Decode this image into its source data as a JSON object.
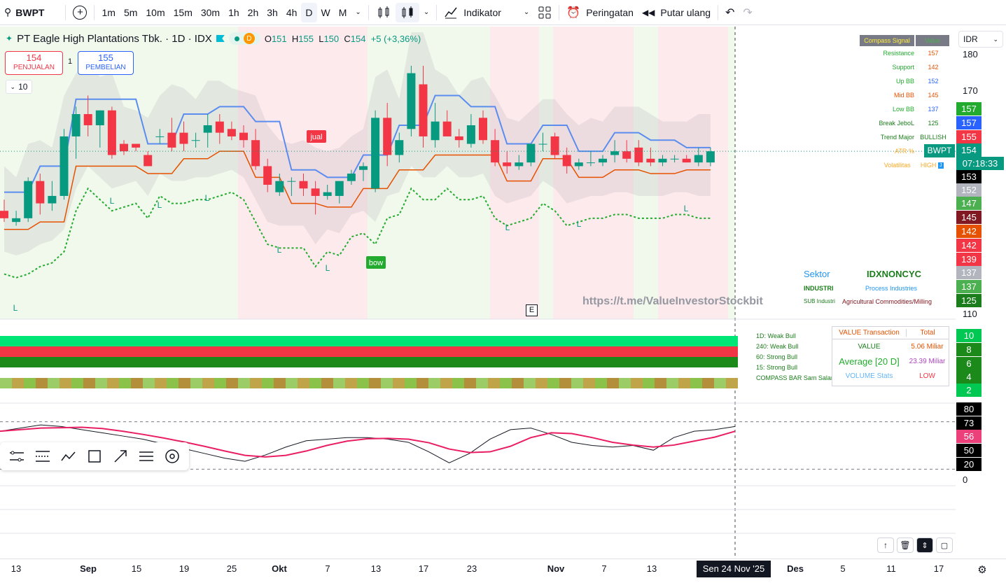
{
  "toolbar": {
    "symbol": "BWPT",
    "intervals": [
      "1m",
      "5m",
      "10m",
      "15m",
      "30m",
      "1h",
      "2h",
      "3h",
      "4h",
      "D",
      "W",
      "M"
    ],
    "selected_interval": "D",
    "indicators_label": "Indikator",
    "alert_label": "Peringatan",
    "replay_label": "Putar ulang"
  },
  "legend": {
    "title": "PT Eagle High Plantations Tbk. · 1D · IDX",
    "badge": "D",
    "o_label": "O",
    "o": "151",
    "h_label": "H",
    "h": "155",
    "l_label": "L",
    "l": "150",
    "c_label": "C",
    "c": "154",
    "change": "+5 (+3,36%)",
    "sell_price": "154",
    "sell_label": "PENJUALAN",
    "spread": "1",
    "buy_price": "155",
    "buy_label": "PEMBELIAN",
    "indicator_count": "10"
  },
  "currency": "IDR",
  "price_scale": {
    "plain_labels": [
      "180",
      "170",
      "110",
      "0"
    ],
    "tags": [
      {
        "text": "157",
        "color": "#22ab2e"
      },
      {
        "text": "157",
        "color": "#2962ff"
      },
      {
        "text": "155",
        "color": "#f23645"
      },
      {
        "text": "154",
        "color": "#089981"
      },
      {
        "text": "07:18:33",
        "color": "#089981"
      },
      {
        "text": "153",
        "color": "#000000"
      },
      {
        "text": "152",
        "color": "#b2b5be"
      },
      {
        "text": "147",
        "color": "#4caf50"
      },
      {
        "text": "145",
        "color": "#801922"
      },
      {
        "text": "142",
        "color": "#e65100"
      },
      {
        "text": "142",
        "color": "#f23645"
      },
      {
        "text": "139",
        "color": "#f23645"
      },
      {
        "text": "137",
        "color": "#b2b5be"
      },
      {
        "text": "137",
        "color": "#4caf50"
      },
      {
        "text": "125",
        "color": "#1b7d1b"
      },
      {
        "text": "10",
        "color": "#00c853"
      },
      {
        "text": "8",
        "color": "#1b8a1b"
      },
      {
        "text": "6",
        "color": "#1b8a1b"
      },
      {
        "text": "4",
        "color": "#1b8a1b"
      },
      {
        "text": "2",
        "color": "#00c853"
      },
      {
        "text": "80",
        "color": "#000000"
      },
      {
        "text": "73",
        "color": "#000000"
      },
      {
        "text": "56",
        "color": "#ec407a"
      },
      {
        "text": "50",
        "color": "#000000"
      },
      {
        "text": "20",
        "color": "#000000"
      }
    ],
    "symbol_tag": "BWPT"
  },
  "compass": {
    "header_signal": "Compass Signal",
    "header_value": "Value",
    "rows": [
      {
        "label": "Resistance",
        "value": "157",
        "lcolor": "#22ab2e",
        "vcolor": "#e65100"
      },
      {
        "label": "Support",
        "value": "142",
        "lcolor": "#22ab2e",
        "vcolor": "#e65100"
      },
      {
        "label": "Up BB",
        "value": "152",
        "lcolor": "#22ab2e",
        "vcolor": "#2962ff"
      },
      {
        "label": "Mid BB",
        "value": "145",
        "lcolor": "#e65100",
        "vcolor": "#e65100"
      },
      {
        "label": "Low BB",
        "value": "137",
        "lcolor": "#22ab2e",
        "vcolor": "#2962ff"
      },
      {
        "label": "Break JeboL",
        "value": "125",
        "lcolor": "#1b7d1b",
        "vcolor": "#1b7d1b"
      },
      {
        "label": "Trend Major",
        "value": "BULLISH",
        "lcolor": "#1b7d1b",
        "vcolor": "#1b7d1b"
      },
      {
        "label": "ATR %",
        "value": "",
        "lcolor": "#f9a825",
        "vcolor": "#f9a825"
      },
      {
        "label": "Volatilitas",
        "value": "HIGH",
        "lcolor": "#f9a825",
        "vcolor": "#f9a825"
      }
    ]
  },
  "sector": {
    "sektor_label": "Sektor",
    "sektor_value": "IDXNONCYC",
    "industri_label": "INDUSTRI",
    "industri_value": "Process Industries",
    "sub_label": "SUB Industri",
    "sub_value": "Agricultural Commodities/Milling"
  },
  "watermark": "https://t.me/ValueInvestorStockbit",
  "signals": {
    "jual": "jual",
    "bow": "bow",
    "L": "L"
  },
  "compass_bar": {
    "labels": [
      "1D: Weak Bull",
      "240: Weak Bull",
      "60: Strong Bull",
      "15: Strong Bull",
      "COMPASS BAR Sam Salamun"
    ]
  },
  "value_table": {
    "h1": "VALUE Transaction",
    "h2": "Total",
    "r1l": "VALUE",
    "r1v": "5.06 Miliar",
    "r2l": "Average [20 D]",
    "r2v": "23.39 Miliar",
    "r3l": "VOLUME Stats",
    "r3v": "LOW"
  },
  "x_axis": {
    "labels": [
      "13",
      "Sep",
      "15",
      "19",
      "25",
      "Okt",
      "7",
      "13",
      "17",
      "23",
      "Nov",
      "7",
      "13",
      "Des",
      "5",
      "11",
      "17"
    ],
    "crosshair_label": "Sen 24 Nov '25"
  },
  "chart_data": {
    "type": "candlestick",
    "ylim": [
      110,
      180
    ],
    "candles": [
      {
        "o": 138,
        "h": 141,
        "l": 135,
        "c": 136
      },
      {
        "o": 135,
        "h": 138,
        "l": 134,
        "c": 136
      },
      {
        "o": 136,
        "h": 147,
        "l": 135,
        "c": 146
      },
      {
        "o": 146,
        "h": 148,
        "l": 137,
        "c": 140
      },
      {
        "o": 140,
        "h": 146,
        "l": 138,
        "c": 142
      },
      {
        "o": 142,
        "h": 160,
        "l": 141,
        "c": 158
      },
      {
        "o": 158,
        "h": 166,
        "l": 152,
        "c": 164
      },
      {
        "o": 164,
        "h": 169,
        "l": 158,
        "c": 161
      },
      {
        "o": 161,
        "h": 165,
        "l": 155,
        "c": 165
      },
      {
        "o": 165,
        "h": 166,
        "l": 152,
        "c": 153
      },
      {
        "o": 156,
        "h": 157,
        "l": 153,
        "c": 154
      },
      {
        "o": 156,
        "h": 156,
        "l": 154,
        "c": 155
      },
      {
        "o": 153,
        "h": 154,
        "l": 150,
        "c": 150
      },
      {
        "o": 158,
        "h": 160,
        "l": 156,
        "c": 158
      },
      {
        "o": 159,
        "h": 163,
        "l": 154,
        "c": 155
      },
      {
        "o": 159,
        "h": 162,
        "l": 154,
        "c": 156
      },
      {
        "o": 157,
        "h": 159,
        "l": 155,
        "c": 157
      },
      {
        "o": 159,
        "h": 164,
        "l": 155,
        "c": 161
      },
      {
        "o": 162,
        "h": 164,
        "l": 156,
        "c": 159
      },
      {
        "o": 160,
        "h": 162,
        "l": 157,
        "c": 158
      },
      {
        "o": 159,
        "h": 161,
        "l": 155,
        "c": 157
      },
      {
        "o": 157,
        "h": 160,
        "l": 149,
        "c": 150
      },
      {
        "o": 150,
        "h": 152,
        "l": 143,
        "c": 145
      },
      {
        "o": 143,
        "h": 148,
        "l": 142,
        "c": 146
      },
      {
        "o": 146,
        "h": 147,
        "l": 142,
        "c": 146
      },
      {
        "o": 146,
        "h": 148,
        "l": 142,
        "c": 144
      },
      {
        "o": 144,
        "h": 146,
        "l": 137,
        "c": 142
      },
      {
        "o": 142,
        "h": 145,
        "l": 141,
        "c": 143
      },
      {
        "o": 142,
        "h": 146,
        "l": 140,
        "c": 146
      },
      {
        "o": 146,
        "h": 149,
        "l": 145,
        "c": 148
      },
      {
        "o": 149,
        "h": 151,
        "l": 146,
        "c": 150
      },
      {
        "o": 144,
        "h": 165,
        "l": 143,
        "c": 163
      },
      {
        "o": 163,
        "h": 167,
        "l": 150,
        "c": 153
      },
      {
        "o": 153,
        "h": 159,
        "l": 151,
        "c": 157
      },
      {
        "o": 160,
        "h": 177,
        "l": 158,
        "c": 175
      },
      {
        "o": 172,
        "h": 177,
        "l": 155,
        "c": 158
      },
      {
        "o": 157,
        "h": 167,
        "l": 155,
        "c": 162
      },
      {
        "o": 162,
        "h": 165,
        "l": 158,
        "c": 158
      },
      {
        "o": 158,
        "h": 160,
        "l": 155,
        "c": 157
      },
      {
        "o": 156,
        "h": 164,
        "l": 155,
        "c": 161
      },
      {
        "o": 163,
        "h": 165,
        "l": 156,
        "c": 157
      },
      {
        "o": 157,
        "h": 160,
        "l": 150,
        "c": 151
      },
      {
        "o": 151,
        "h": 154,
        "l": 148,
        "c": 150
      },
      {
        "o": 150,
        "h": 153,
        "l": 149,
        "c": 151
      },
      {
        "o": 151,
        "h": 156,
        "l": 150,
        "c": 156
      },
      {
        "o": 156,
        "h": 159,
        "l": 154,
        "c": 156
      },
      {
        "o": 158,
        "h": 159,
        "l": 152,
        "c": 153
      },
      {
        "o": 153,
        "h": 155,
        "l": 148,
        "c": 150
      },
      {
        "o": 150,
        "h": 152,
        "l": 149,
        "c": 151
      },
      {
        "o": 151,
        "h": 154,
        "l": 150,
        "c": 151
      },
      {
        "o": 151,
        "h": 153,
        "l": 150,
        "c": 152
      },
      {
        "o": 153,
        "h": 157,
        "l": 151,
        "c": 154
      },
      {
        "o": 154,
        "h": 157,
        "l": 151,
        "c": 152
      },
      {
        "o": 155,
        "h": 157,
        "l": 150,
        "c": 151
      },
      {
        "o": 152,
        "h": 155,
        "l": 150,
        "c": 151
      },
      {
        "o": 151,
        "h": 153,
        "l": 150,
        "c": 152
      },
      {
        "o": 152,
        "h": 153,
        "l": 151,
        "c": 152
      },
      {
        "o": 152,
        "h": 153,
        "l": 151,
        "c": 151
      },
      {
        "o": 151,
        "h": 155,
        "l": 150,
        "c": 153
      },
      {
        "o": 151,
        "h": 155,
        "l": 150,
        "c": 154
      }
    ],
    "oscillator": {
      "levels": [
        80,
        20
      ],
      "series": [
        {
          "values": [
            68,
            72,
            76,
            74,
            70,
            66,
            62,
            58,
            52,
            46,
            40,
            34,
            30,
            38,
            48,
            56,
            58,
            60,
            60,
            58,
            54,
            42,
            28,
            40,
            58,
            70,
            72,
            64,
            54,
            50,
            48,
            50,
            44,
            60,
            68,
            70,
            74
          ]
        }
      ]
    }
  }
}
